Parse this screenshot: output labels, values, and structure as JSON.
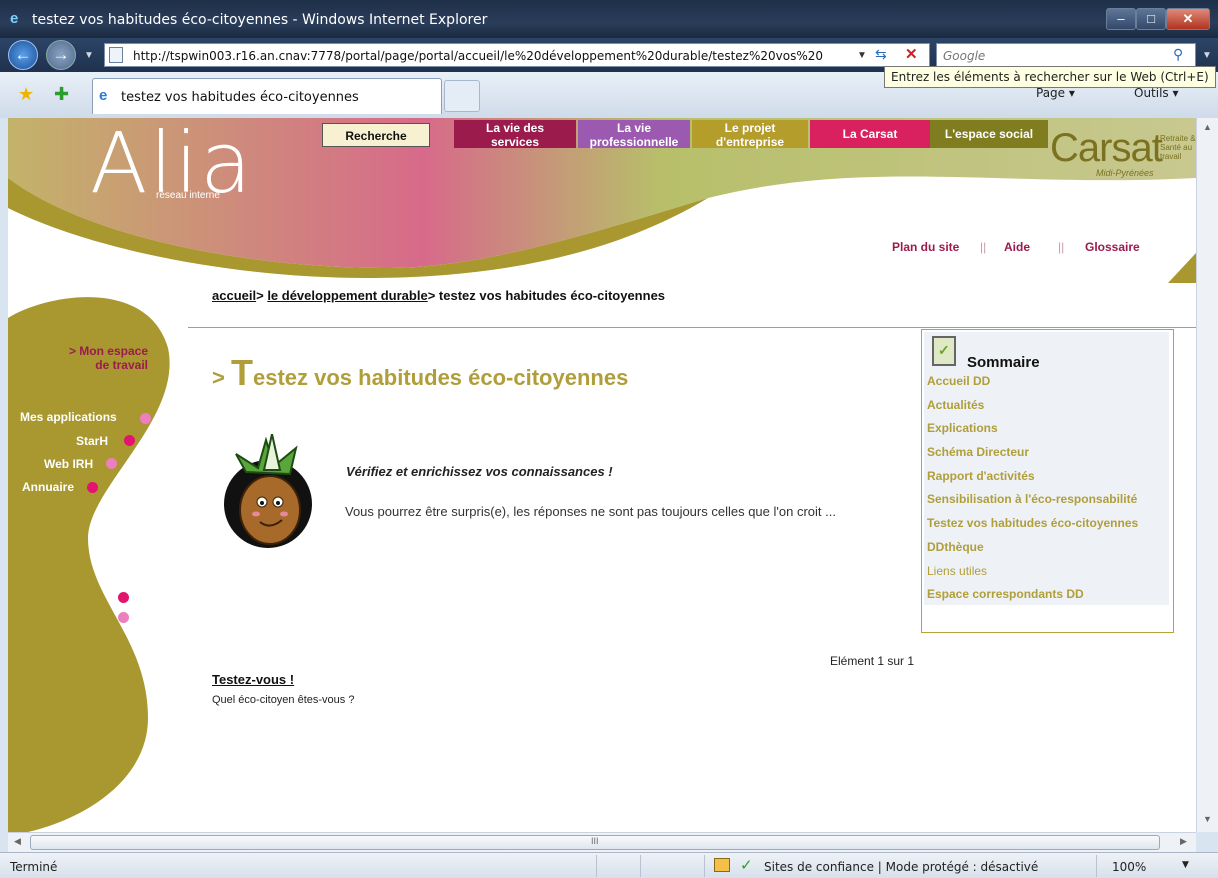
{
  "window": {
    "title": "testez vos habitudes éco-citoyennes - Windows Internet Explorer",
    "minimize": "–",
    "maximize": "□",
    "close": "✕"
  },
  "address": {
    "url": "http://tspwin003.r16.an.cnav:7778/portal/page/portal/accueil/le%20développement%20durable/testez%20vos%20",
    "search_placeholder": "Google",
    "tooltip": "Entrez les éléments à rechercher sur le Web (Ctrl+E)"
  },
  "tab": {
    "title": "testez vos habitudes éco-citoyennes"
  },
  "commandbar": {
    "page": "Page ▾",
    "tools": "Outils ▾"
  },
  "site": {
    "logo": "Alia",
    "logo_sub": "réseau interne",
    "menu": {
      "recherche": "Recherche",
      "vie_services_1": "La vie des",
      "vie_services_2": "services",
      "vie_pro_1": "La vie",
      "vie_pro_2": "professionnelle",
      "projet_1": "Le projet",
      "projet_2": "d'entreprise",
      "carsat": "La Carsat",
      "espace_social": "L'espace social"
    },
    "brand": {
      "name": "Carsat",
      "side": "Retraite & Santé au travail",
      "region": "Midi-Pyrénées"
    },
    "toplinks": {
      "plan": "Plan du site",
      "sep1": "||",
      "aide": "Aide",
      "sep2": "||",
      "glossaire": "Glossaire"
    },
    "breadcrumb": {
      "home": "accueil",
      "sep": ">",
      "section": "le développement durable",
      "current": "testez vos habitudes éco-citoyennes"
    },
    "leftnav": {
      "espace_1": "> Mon espace",
      "espace_2": "de travail",
      "apps": "Mes applications",
      "starh": "StarH",
      "webirh": "Web IRH",
      "annuaire": "Annuaire"
    },
    "content": {
      "title_prefix": "> ",
      "title_initial": "T",
      "title_rest": "estez vos habitudes éco-citoyennes",
      "lead": "Vérifiez et enrichissez vos connaissances !",
      "body": "Vous pourrez être surpris(e), les réponses ne sont pas toujours celles que l'on croit ...",
      "pagination": "Elément 1 sur 1",
      "link_title": "Testez-vous !",
      "link_sub": "Quel éco-citoyen êtes-vous ?"
    },
    "sommaire": {
      "title": "Sommaire",
      "items": [
        "Accueil DD",
        "Actualités",
        "Explications",
        "Schéma Directeur",
        "Rapport d'activités",
        "Sensibilisation à l'éco-responsabilité",
        "Testez vos habitudes éco-citoyennes",
        "DDthèque",
        "Liens utiles",
        "Espace correspondants DD"
      ]
    }
  },
  "statusbar": {
    "status": "Terminé",
    "zone": "Sites de confiance | Mode protégé : désactivé",
    "zoom": "100%"
  },
  "colors": {
    "olive": "#b09e3a",
    "magenta": "#9b1b4d",
    "pink": "#e2146f",
    "ie_frame": "#1f324f"
  }
}
